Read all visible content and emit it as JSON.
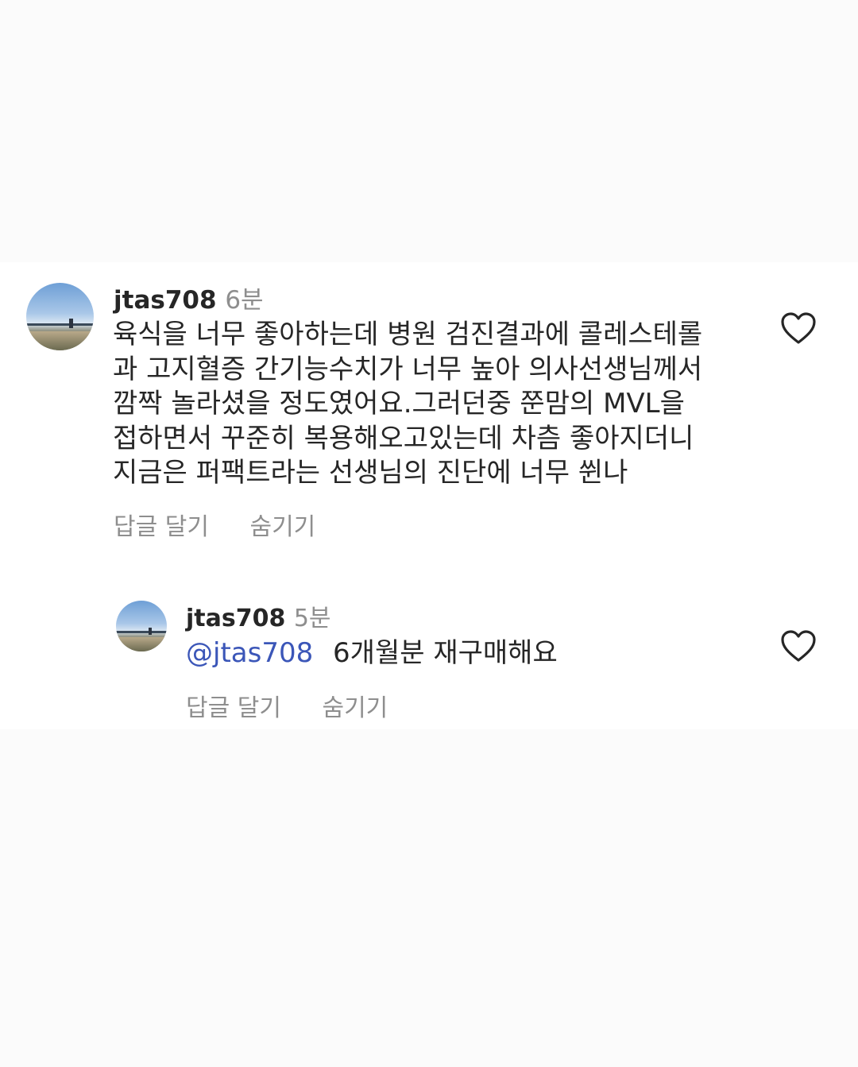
{
  "comment": {
    "username": "jtas708",
    "time": "6분",
    "lines": [
      "육식을 너무 좋아하는데 병원 검진결과에 콜레스테롤",
      "과 고지혈증 간기능수치가 너무 높아 의사선생님께서",
      "깜짝 놀라셨을 정도였어요.그러던중 쭌맘의 MVL을",
      "접하면서 꾸준히 복용해오고있는데  차츰 좋아지더니",
      "지금은 퍼팩트라는 선생님의 진단에 너무 쒼나"
    ],
    "reply_label": "답글 달기",
    "hide_label": "숨기기",
    "like_icon": "heart-outline-icon"
  },
  "reply": {
    "username": "jtas708",
    "time": "5분",
    "mention": "@jtas708",
    "text": "6개월분 재구매해요",
    "reply_label": "답글 달기",
    "hide_label": "숨기기",
    "like_icon": "heart-outline-icon"
  },
  "colors": {
    "mention": "#3b56b8",
    "meta": "#8e8e8e",
    "text": "#262626"
  }
}
